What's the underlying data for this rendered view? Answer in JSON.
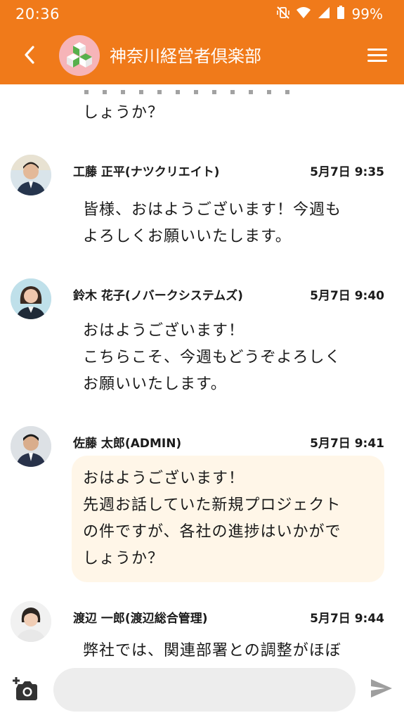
{
  "status_bar": {
    "time": "20:36",
    "battery": "99%",
    "icons": [
      "vibrate-off-icon",
      "wifi-icon",
      "cellular-signal-icon",
      "battery-icon"
    ]
  },
  "header": {
    "title": "神奈川経営者倶楽部",
    "back_icon": "chevron-left-icon",
    "menu_icon": "hamburger-menu-icon",
    "background_color": "#f07a1a"
  },
  "chat": {
    "previous_message_tail": "しょうか？",
    "messages": [
      {
        "name": "工藤 正平(ナツクリエイト)",
        "time": "5月7日 9:35",
        "text": "皆様、おはようございます！今週も\nよろしくお願いいたします。",
        "highlighted": false
      },
      {
        "name": "鈴木 花子(ノバークシステムズ)",
        "time": "5月7日 9:40",
        "text": "おはようございます！\nこちらこそ、今週もどうぞよろしく\nお願いいたします。",
        "highlighted": false
      },
      {
        "name": "佐藤 太郎(ADMIN)",
        "time": "5月7日 9:41",
        "text": "おはようございます！\n先週お話していた新規プロジェクト\nの件ですが、各社の進捗はいかがで\nしょうか？",
        "highlighted": true,
        "highlight_color": "#fff6e8"
      },
      {
        "name": "渡辺 一郎(渡辺総合管理)",
        "time": "5月7日 9:44",
        "text": "弊社では、関連部署との調整がほぼ",
        "highlighted": false
      }
    ]
  },
  "composer": {
    "input_value": "",
    "camera_icon": "add-photo-camera-icon",
    "send_icon": "send-icon"
  }
}
